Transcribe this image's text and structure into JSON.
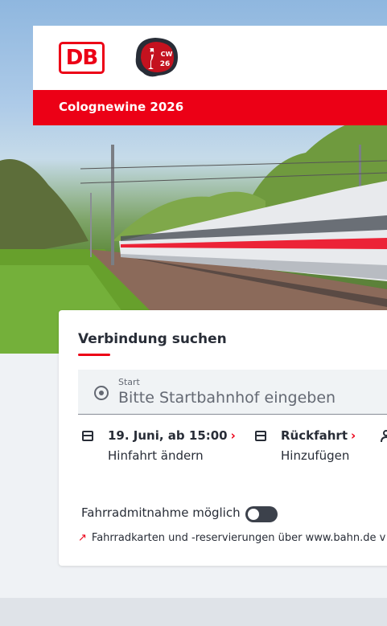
{
  "header": {
    "db_logo_text": "DB",
    "event_logo_text": "CW 26",
    "banner_title": "Colognewine 2026"
  },
  "search": {
    "title": "Verbindung suchen",
    "start_label": "Start",
    "start_placeholder": "Bitte Startbahnhof eingeben",
    "outbound": {
      "main": "19. Juni, ab 15:00",
      "sub": "Hinfahrt ändern",
      "icon": "calendar-icon"
    },
    "return": {
      "main": "Rückfahrt",
      "sub": "Hinzufügen",
      "icon": "calendar-icon"
    },
    "chevron": "›",
    "bike_label": "Fahrradmitnahme möglich",
    "bike_toggle_on": false,
    "link_text": "Fahrradkarten und -reservierungen über www.bahn.de v",
    "link_arrow": "↗"
  },
  "colors": {
    "db_red": "#ec0016",
    "text": "#282d37",
    "field_bg": "#f0f3f5",
    "page_bg": "#eff2f5"
  }
}
